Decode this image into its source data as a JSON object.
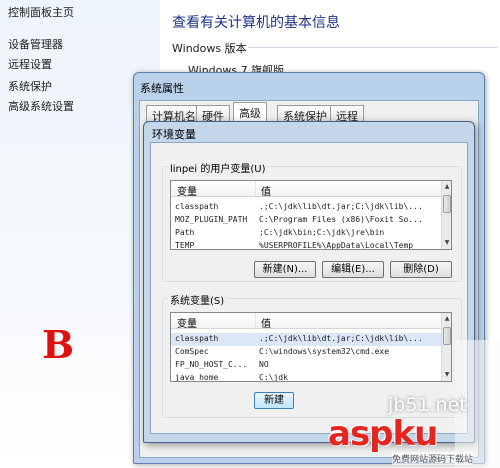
{
  "control_panel": {
    "home": "控制面板主页",
    "links": [
      "设备管理器",
      "远程设置",
      "系统保护",
      "高级系统设置"
    ],
    "heading": "查看有关计算机的基本信息",
    "edition_label": "Windows 版本",
    "edition_value": "Windows 7 旗舰版"
  },
  "system_properties": {
    "title": "系统属性",
    "tabs": [
      "计算机名",
      "硬件",
      "高级",
      "系统保护",
      "远程"
    ]
  },
  "env_dialog": {
    "title": "环境变量",
    "user_group_label": "linpei 的用户变量(U)",
    "system_group_label": "系统变量(S)",
    "col_variable": "变量",
    "col_value": "值",
    "user_vars": [
      {
        "name": "classpath",
        "value": ".;C:\\jdk\\lib\\dt.jar;C:\\jdk\\lib\\..."
      },
      {
        "name": "MOZ_PLUGIN_PATH",
        "value": "C:\\Program Files (x86)\\Foxit So..."
      },
      {
        "name": "Path",
        "value": ";C:\\jdk\\bin;C:\\jdk\\jre\\bin"
      },
      {
        "name": "TEMP",
        "value": "%USERPROFILE%\\AppData\\Local\\Temp"
      }
    ],
    "system_vars": [
      {
        "name": "classpath",
        "value": ".;C:\\jdk\\lib\\dt.jar;C:\\jdk\\lib\\..."
      },
      {
        "name": "ComSpec",
        "value": "C:\\windows\\system32\\cmd.exe"
      },
      {
        "name": "FP_NO_HOST_C...",
        "value": "NO"
      },
      {
        "name": "java_home",
        "value": "C:\\jdk"
      }
    ],
    "buttons": {
      "new": "新建(N)...",
      "edit": "编辑(E)...",
      "delete": "删除(D)",
      "new_system": "新建"
    }
  },
  "annotation": "B",
  "watermark": {
    "site": "jb51.net",
    "brand": "aspku",
    "tagline": "免费网站源码下载站"
  }
}
